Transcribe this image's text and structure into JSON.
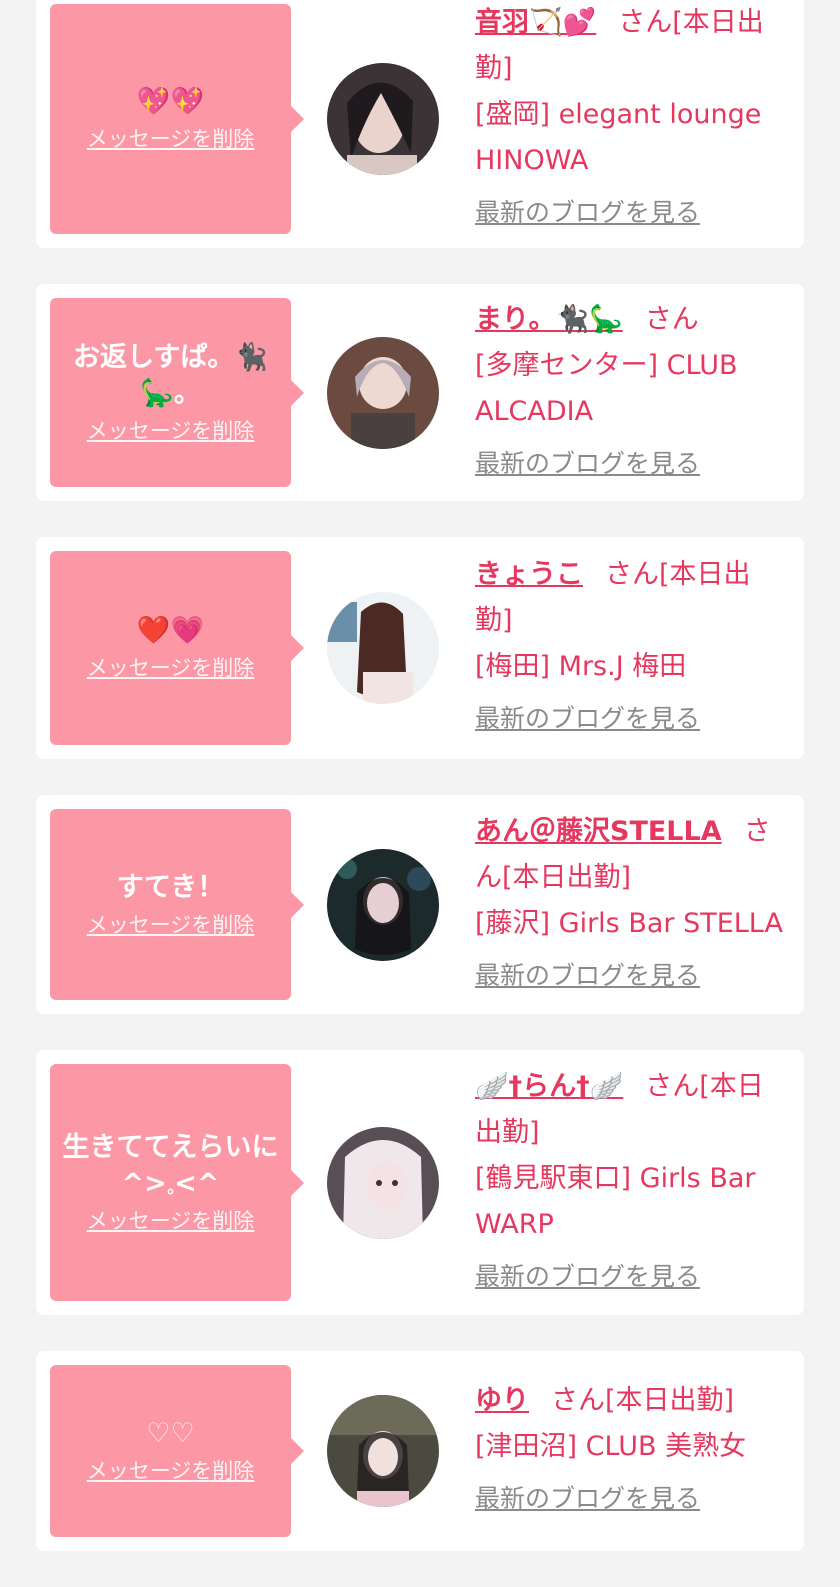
{
  "delete_label": "メッセージを削除",
  "blog_label": "最新のブログを見る",
  "colors": {
    "bubble": "#fc98a6",
    "accent_text": "#e6385f",
    "muted_link": "#8a8a8a",
    "background": "#f3f3f3"
  },
  "messages": [
    {
      "message": "💖💖",
      "name": "音羽🏹💕",
      "honorific": "さん[本日出勤]",
      "shop": "[盛岡] elegant lounge HINOWA"
    },
    {
      "message": "お返しすぱ。🐈‍⬛🦕。",
      "name": "まり。🐈‍⬛🦕",
      "honorific": "さん",
      "shop": "[多摩センター] CLUB ALCADIA"
    },
    {
      "message": "❤️💗",
      "name": "きょうこ",
      "honorific": "さん[本日出勤]",
      "shop": "[梅田] Mrs.J 梅田"
    },
    {
      "message": "すてき！",
      "name": "あん＠藤沢STELLA",
      "honorific": "さん[本日出勤]",
      "shop": "[藤沢] Girls Bar STELLA"
    },
    {
      "message": "生きててえらいに^>𓈒<^",
      "name": "🪽†らん†🪽",
      "honorific": "さん[本日出勤]",
      "shop": "[鶴見駅東口] Girls Bar WARP"
    },
    {
      "message": "♡♡",
      "name": "ゆり",
      "honorific": "さん[本日出勤]",
      "shop": "[津田沼] CLUB 美熟女"
    }
  ]
}
